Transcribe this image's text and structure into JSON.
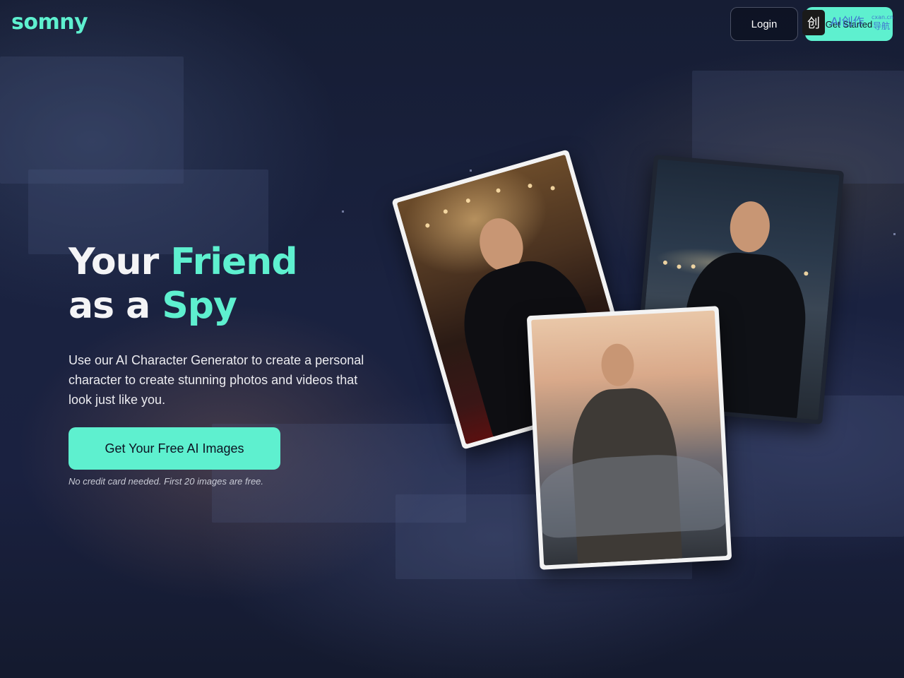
{
  "header": {
    "logo": "somny",
    "login_label": "Login",
    "start_label": "Get Started"
  },
  "watermark": {
    "icon": "创",
    "text": "AI创作",
    "sub": "cxan.cn",
    "sub2": "导航"
  },
  "hero": {
    "title_line1_plain": "Your ",
    "title_line1_accent": "Friend",
    "title_line2_plain": "as a ",
    "title_line2_accent": "Spy",
    "description": "Use our AI Character Generator to create a personal character to create stunning photos and videos that look just like you.",
    "cta_label": "Get Your Free AI Images",
    "note": "No credit card needed. First 20 images are free."
  },
  "colors": {
    "accent": "#5ef0cf",
    "background": "#1a2240"
  }
}
